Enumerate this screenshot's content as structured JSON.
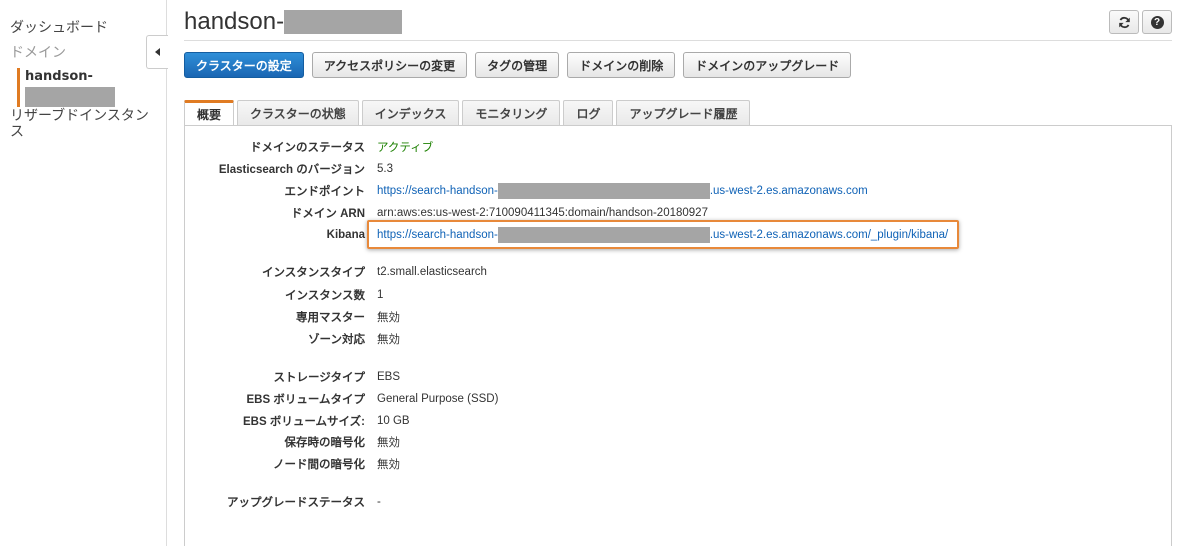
{
  "sidebar": {
    "dashboard": "ダッシュボード",
    "domains": "ドメイン",
    "current_domain": "handson-",
    "reserved": "リザーブドインスタンス"
  },
  "header": {
    "title": "handson-"
  },
  "actions": [
    "クラスターの設定",
    "アクセスポリシーの変更",
    "タグの管理",
    "ドメインの削除",
    "ドメインのアップグレード"
  ],
  "tabs": [
    "概要",
    "クラスターの状態",
    "インデックス",
    "モニタリング",
    "ログ",
    "アップグレード履歴"
  ],
  "details": {
    "status": {
      "label": "ドメインのステータス",
      "value": "アクティブ"
    },
    "version": {
      "label": "Elasticsearch のバージョン",
      "value": "5.3"
    },
    "endpoint": {
      "label": "エンドポイント",
      "prefix": "https://search-handson-",
      "suffix": ".us-west-2.es.amazonaws.com"
    },
    "arn": {
      "label": "ドメイン ARN",
      "value": "arn:aws:es:us-west-2:710090411345:domain/handson-20180927"
    },
    "kibana": {
      "label": "Kibana",
      "prefix": "https://search-handson-",
      "suffix": ".us-west-2.es.amazonaws.com/_plugin/kibana/"
    },
    "instance_type": {
      "label": "インスタンスタイプ",
      "value": "t2.small.elasticsearch"
    },
    "instance_count": {
      "label": "インスタンス数",
      "value": "1"
    },
    "dedicated_master": {
      "label": "専用マスター",
      "value": "無効"
    },
    "zone_awareness": {
      "label": "ゾーン対応",
      "value": "無効"
    },
    "storage_type": {
      "label": "ストレージタイプ",
      "value": "EBS"
    },
    "ebs_volume_type": {
      "label": "EBS ボリュームタイプ",
      "value": "General Purpose (SSD)"
    },
    "ebs_volume_size": {
      "label": "EBS ボリュームサイズ:",
      "value": "10 GB"
    },
    "encryption_at_rest": {
      "label": "保存時の暗号化",
      "value": "無効"
    },
    "node_to_node_encryption": {
      "label": "ノード間の暗号化",
      "value": "無効"
    },
    "upgrade_status": {
      "label": "アップグレードステータス",
      "value": "-"
    }
  },
  "colors": {
    "accent_orange": "#e07b22",
    "primary_blue": "#1a66b3",
    "link_blue": "#0f62b6",
    "status_green": "#1d8102",
    "redaction_gray": "#a5a5a5"
  },
  "icons": {
    "refresh": "refresh-icon",
    "help": "help-icon",
    "collapse": "collapse-sidebar-icon"
  }
}
